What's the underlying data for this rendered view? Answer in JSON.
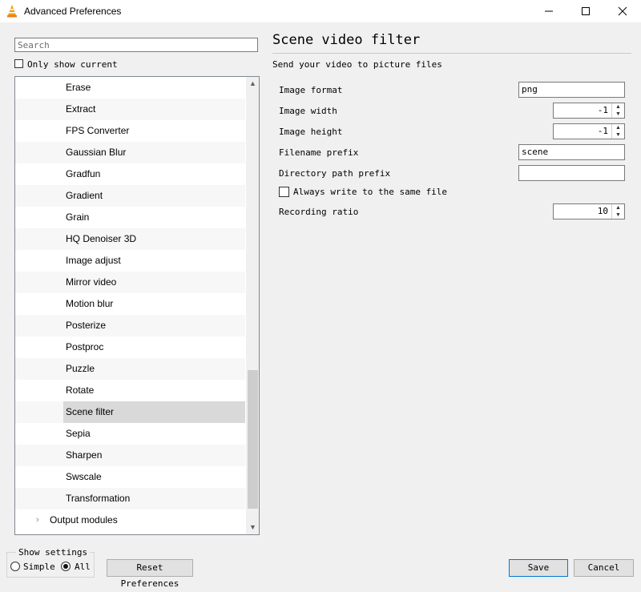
{
  "window": {
    "title": "Advanced Preferences",
    "icon": "vlc-cone-icon",
    "controls": [
      "minimize-icon",
      "maximize-icon",
      "close-icon"
    ]
  },
  "search": {
    "placeholder": "Search"
  },
  "only_show_current": {
    "label": "Only show current",
    "checked": false
  },
  "tree": {
    "items": [
      {
        "label": "Erase"
      },
      {
        "label": "Extract"
      },
      {
        "label": "FPS Converter"
      },
      {
        "label": "Gaussian Blur"
      },
      {
        "label": "Gradfun"
      },
      {
        "label": "Gradient"
      },
      {
        "label": "Grain"
      },
      {
        "label": "HQ Denoiser 3D"
      },
      {
        "label": "Image adjust"
      },
      {
        "label": "Mirror video"
      },
      {
        "label": "Motion blur"
      },
      {
        "label": "Posterize"
      },
      {
        "label": "Postproc"
      },
      {
        "label": "Puzzle"
      },
      {
        "label": "Rotate"
      },
      {
        "label": "Scene filter",
        "selected": true
      },
      {
        "label": "Sepia"
      },
      {
        "label": "Sharpen"
      },
      {
        "label": "Swscale"
      },
      {
        "label": "Transformation"
      }
    ],
    "parent_item": {
      "label": "Output modules"
    }
  },
  "panel": {
    "title": "Scene video filter",
    "description": "Send your video to picture files",
    "fields": {
      "image_format": {
        "label": "Image format",
        "value": "png"
      },
      "image_width": {
        "label": "Image width",
        "value": "-1"
      },
      "image_height": {
        "label": "Image height",
        "value": "-1"
      },
      "filename_prefix": {
        "label": "Filename prefix",
        "value": "scene"
      },
      "directory_path_prefix": {
        "label": "Directory path prefix",
        "value": ""
      },
      "always_same_file": {
        "label": "Always write to the same file",
        "checked": false
      },
      "recording_ratio": {
        "label": "Recording ratio",
        "value": "10"
      }
    }
  },
  "show_settings": {
    "label": "Show settings",
    "simple_label": "Simple",
    "all_label": "All",
    "selected": "All"
  },
  "buttons": {
    "reset": "Reset Preferences",
    "save": "Save",
    "cancel": "Cancel"
  }
}
